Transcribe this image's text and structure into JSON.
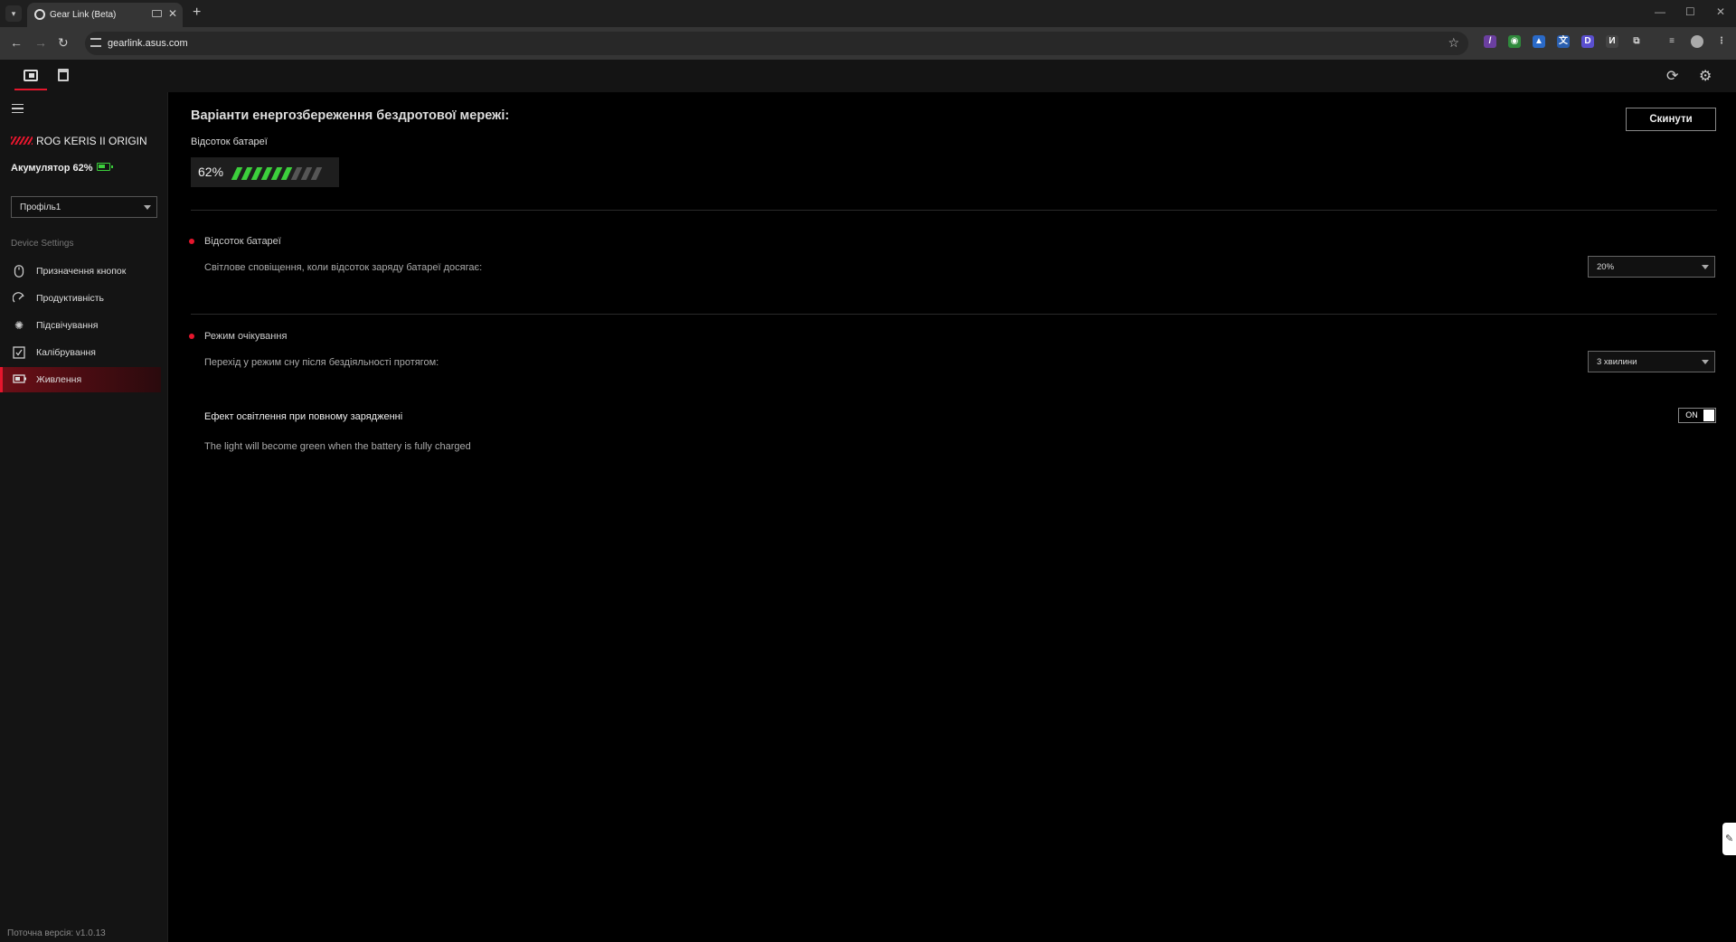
{
  "browser": {
    "tab_title": "Gear Link (Beta)",
    "url": "gearlink.asus.com"
  },
  "sidebar": {
    "device_name": "ROG KERIS II ORIGIN",
    "battery_label": "Акумулятор 62%",
    "profile_select": "Профіль1",
    "section_label": "Device Settings",
    "items": [
      {
        "label": "Призначення кнопок",
        "icon": "mouse-icon"
      },
      {
        "label": "Продуктивність",
        "icon": "performance-icon"
      },
      {
        "label": "Підсвічування",
        "icon": "lighting-icon"
      },
      {
        "label": "Калібрування",
        "icon": "calibration-icon"
      },
      {
        "label": "Живлення",
        "icon": "power-icon",
        "active": true
      }
    ],
    "version": "Поточна версія: v1.0.13"
  },
  "main": {
    "title": "Варіанти енергозбереження бездротової мережі:",
    "reset_button": "Скинути",
    "battery_level_label": "Відсоток батареї",
    "battery_percent": "62%",
    "battery_fraction": 0.62,
    "low_battery": {
      "title": "Відсоток батареї",
      "description": "Світлове сповіщення, коли відсоток заряду батареї досягає:",
      "value": "20%"
    },
    "standby": {
      "title": "Режим очікування",
      "description": "Перехід у режим сну після бездіяльності протягом:",
      "value": "3 хвилини"
    },
    "charge_effect": {
      "title": "Ефект освітлення при повному зарядженні",
      "toggle": "ON",
      "description": "The light will become green when the battery is fully charged"
    }
  },
  "colors": {
    "accent": "#e5162d",
    "battery_green": "#3ccf3c"
  }
}
